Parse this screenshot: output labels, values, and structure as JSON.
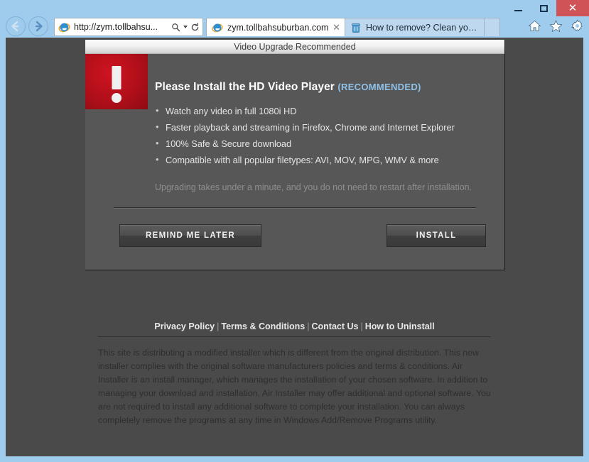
{
  "browser": {
    "window_controls": {
      "minimize": "—",
      "maximize": "□",
      "close": "✕"
    },
    "nav": {
      "back_label": "Back",
      "forward_label": "Forward"
    },
    "address": {
      "url": "http://zym.tollbahsu...",
      "search_icon": "search-icon",
      "refresh_icon": "↻"
    },
    "tabs": [
      {
        "title": "zym.tollbahsuburban.com",
        "close": "✕",
        "active": true,
        "favicon": "ie-icon"
      },
      {
        "title": "How to remove? Clean your co...",
        "close": "",
        "active": false,
        "favicon": "trash-icon"
      }
    ],
    "commands": {
      "home": "home-icon",
      "favorites": "star-icon",
      "settings": "gear-icon"
    }
  },
  "dialog": {
    "header_title": "Video Upgrade Recommended",
    "alert_icon": "exclamation-icon",
    "title": "Please Install the HD Video Player",
    "title_badge": "(RECOMMENDED)",
    "bullets": [
      "Watch any video in full 1080i HD",
      "Faster playback and streaming in Firefox, Chrome and Internet Explorer",
      "100% Safe & Secure download",
      "Compatible with all popular filetypes: AVI, MOV,  MPG, WMV & more"
    ],
    "note": "Upgrading takes under a minute, and you do not need to restart after installation.",
    "buttons": {
      "remind": "REMIND ME LATER",
      "install": "INSTALL"
    }
  },
  "footer": {
    "links": [
      "Privacy Policy",
      "Terms & Conditions",
      "Contact Us",
      "How to Uninstall"
    ],
    "separator": "|",
    "disclaimer": "This site is distributing a modified installer which is different from the original distribution. This new installer complies with the original software manufacturers policies and terms & conditions. Air Installer is an install manager, which manages the installation of your chosen software. In addition to managing your download and installation, Air Installer may offer additional and optional software. You are not required to install any additional software to complete your installation. You can always completely remove the programs at any time in Windows Add/Remove Programs utility."
  },
  "colors": {
    "chrome_blue": "#9fcbec",
    "page_bg": "#4a4a4a",
    "dialog_bg": "#575757",
    "alert_red": "#b00f19",
    "accent_blue": "#8fc2e8",
    "close_red": "#d05358"
  }
}
